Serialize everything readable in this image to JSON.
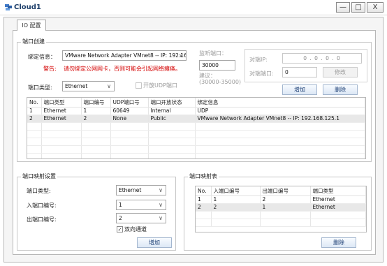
{
  "window": {
    "title": "Cloud1",
    "minimize": "—",
    "maximize": "□",
    "close": "X"
  },
  "tab": {
    "label": "IO 配置"
  },
  "port_create": {
    "title": "端口创建",
    "bind_label": "绑定信息：",
    "bind_value": "VMware Network Adapter VMnet8 -- IP: 192.16",
    "warn_label": "警告:",
    "warn_text": "请勿绑定公网网卡，否则可能会引起网络瘫痪。",
    "type_label": "端口类型:",
    "type_value": "Ethernet",
    "udp_checkbox": "开放UDP端口",
    "listen_label": "监听端口：",
    "listen_value": "30000",
    "suggest_label": "建议：",
    "suggest_range": "(30000-35000)",
    "peer_ip_label": "对端IP:",
    "peer_ip_value": "0 . 0 . 0 . 0",
    "peer_port_label": "对端端口:",
    "peer_port_value": "0",
    "modify_button": "修改",
    "add_button": "增加",
    "delete_button": "删除",
    "table": {
      "headers": [
        "No.",
        "端口类型",
        "端口编号",
        "UDP端口号",
        "端口开放状态",
        "绑定信息"
      ],
      "rows": [
        [
          "1",
          "Ethernet",
          "1",
          "60649",
          "Internal",
          "UDP"
        ],
        [
          "2",
          "Ethernet",
          "2",
          "None",
          "Public",
          "VMware Network Adapter VMnet8 -- IP: 192.168.125.1"
        ]
      ]
    }
  },
  "port_map_settings": {
    "title": "端口映射设置",
    "type_label": "端口类型:",
    "type_value": "Ethernet",
    "in_label": "入端口编号:",
    "in_value": "1",
    "out_label": "出端口编号:",
    "out_value": "2",
    "bidirectional": "双向通道",
    "add_button": "增加"
  },
  "port_map_table": {
    "title": "端口映射表",
    "headers": [
      "No.",
      "入端口编号",
      "出端口编号",
      "端口类型"
    ],
    "rows": [
      [
        "1",
        "1",
        "2",
        "Ethernet"
      ],
      [
        "2",
        "2",
        "1",
        "Ethernet"
      ]
    ],
    "delete_button": "删除"
  },
  "colors": {
    "title_text": "#1e3f6a",
    "warning": "#d40000",
    "button_text": "#1b3e74"
  },
  "icons": {
    "app": "cloud-app-icon",
    "checkbox": "check-mark"
  }
}
